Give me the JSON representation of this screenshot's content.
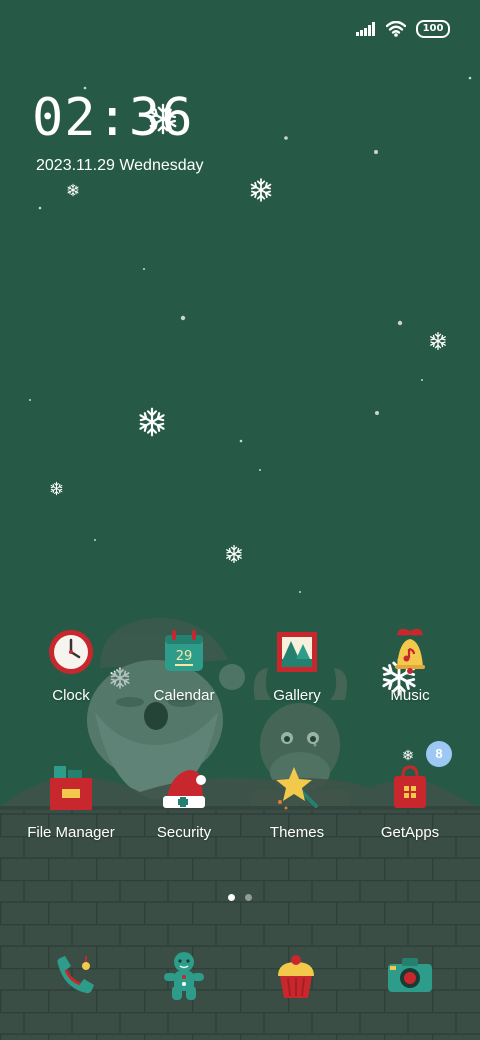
{
  "status": {
    "battery": "100"
  },
  "lock": {
    "time": "02:36",
    "date": "2023.11.29 Wednesday"
  },
  "apps_row1": [
    {
      "label": "Clock",
      "icon": "clock-icon"
    },
    {
      "label": "Calendar",
      "icon": "calendar-icon",
      "day": "29"
    },
    {
      "label": "Gallery",
      "icon": "gallery-icon"
    },
    {
      "label": "Music",
      "icon": "bell-icon"
    }
  ],
  "apps_row2": [
    {
      "label": "File Manager",
      "icon": "gift-icon"
    },
    {
      "label": "Security",
      "icon": "santa-hat-icon"
    },
    {
      "label": "Themes",
      "icon": "star-wand-icon"
    },
    {
      "label": "GetApps",
      "icon": "shopping-bag-icon",
      "badge": "8"
    }
  ],
  "dock": [
    "phone-icon",
    "gingerbread-icon",
    "cupcake-icon",
    "camera-icon"
  ],
  "pager": {
    "pages": 2,
    "current": 1
  },
  "colors": {
    "background": "#265a47",
    "brick": "#3a4e46",
    "accent_red": "#c8282d",
    "accent_teal": "#2e9c8a"
  }
}
